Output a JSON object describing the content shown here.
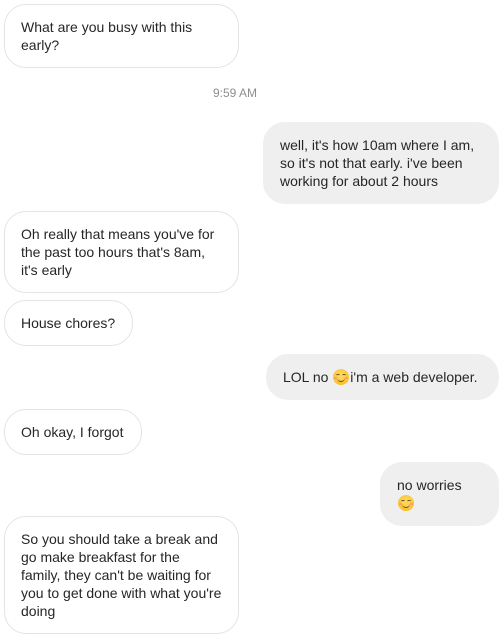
{
  "conversation": {
    "messages": [
      {
        "sender": "other",
        "text": "What are you busy with this early?"
      },
      {
        "sender": "self",
        "text": "well, it's how 10am where I am, so it's not that early. i've been working for about 2 hours"
      },
      {
        "sender": "other",
        "text": "Oh really that means you've for the past too hours that's 8am, it's early"
      },
      {
        "sender": "other",
        "text": "House chores?"
      },
      {
        "sender": "self",
        "text_before": "LOL no ",
        "emoji": "smiling-face-icon",
        "text_after": "i'm a web developer."
      },
      {
        "sender": "other",
        "text": "Oh okay, I forgot"
      },
      {
        "sender": "self",
        "text_before": "no worries ",
        "emoji": "smiling-face-icon"
      },
      {
        "sender": "other",
        "text": "So you should take a break and go make breakfast for the family, they can't be waiting for you to get done with what you're doing"
      }
    ],
    "timestamp": "9:59 AM"
  },
  "colors": {
    "incoming_bubble": "#ffffff",
    "incoming_border": "#e4e4e4",
    "outgoing_bubble": "#efefef",
    "text": "#262626",
    "timestamp": "#8e8e8e"
  }
}
